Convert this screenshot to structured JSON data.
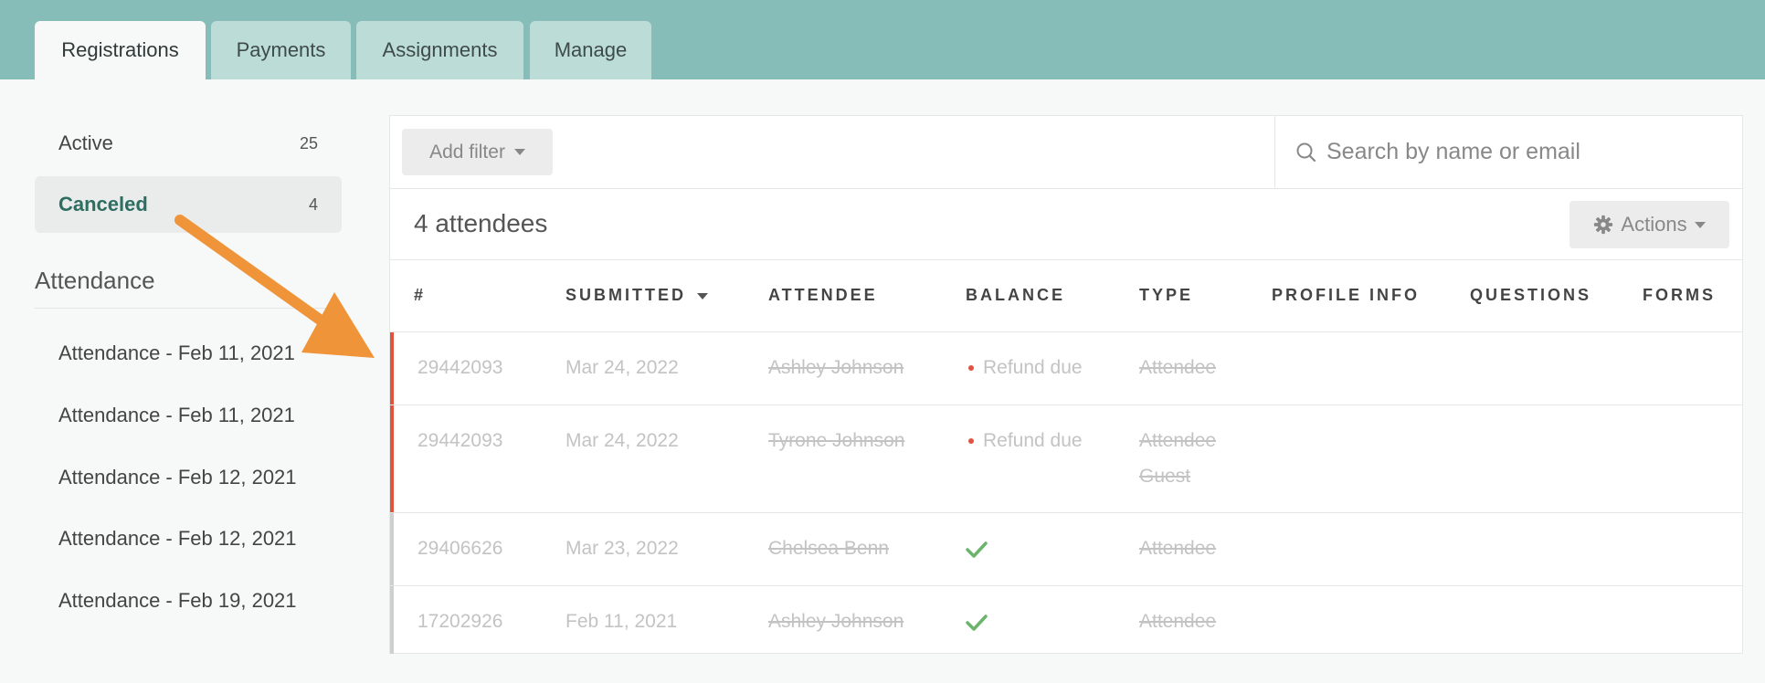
{
  "tabs": [
    {
      "label": "Registrations"
    },
    {
      "label": "Payments"
    },
    {
      "label": "Assignments"
    },
    {
      "label": "Manage"
    }
  ],
  "sidebar": {
    "statuses": [
      {
        "label": "Active",
        "count": "25"
      },
      {
        "label": "Canceled",
        "count": "4"
      }
    ],
    "attendance_heading": "Attendance",
    "attendance_items": [
      {
        "label": "Attendance - Feb 11, 2021"
      },
      {
        "label": "Attendance - Feb 11, 2021"
      },
      {
        "label": "Attendance - Feb 12, 2021"
      },
      {
        "label": "Attendance - Feb 12, 2021"
      },
      {
        "label": "Attendance - Feb 19, 2021"
      }
    ]
  },
  "filter": {
    "add_filter_label": "Add filter",
    "search_placeholder": "Search by name or email"
  },
  "summary": {
    "attendee_count": "4 attendees",
    "actions_label": "Actions"
  },
  "table": {
    "headers": {
      "number": "#",
      "submitted": "SUBMITTED",
      "attendee": "ATTENDEE",
      "balance": "BALANCE",
      "type": "TYPE",
      "profile_info": "PROFILE INFO",
      "questions": "QUESTIONS",
      "forms": "FORMS"
    },
    "rows": [
      {
        "number": "29442093",
        "submitted": "Mar 24, 2022",
        "attendee": "Ashley Johnson",
        "balance": "Refund due",
        "type_1": "Attendee",
        "type_2": ""
      },
      {
        "number": "29442093",
        "submitted": "Mar 24, 2022",
        "attendee": "Tyrone Johnson",
        "balance": "Refund due",
        "type_1": "Attendee",
        "type_2": "Guest"
      },
      {
        "number": "29406626",
        "submitted": "Mar 23, 2022",
        "attendee": "Chelsea Benn",
        "balance": "",
        "type_1": "Attendee",
        "type_2": ""
      },
      {
        "number": "17202926",
        "submitted": "Feb 11, 2021",
        "attendee": "Ashley Johnson",
        "balance": "",
        "type_1": "Attendee",
        "type_2": ""
      }
    ]
  },
  "colors": {
    "header_bg": "#87bdb9",
    "refund_bar": "#e0533f",
    "paid_bar": "#cfcfcf",
    "check": "#6cb46c",
    "arrow": "#f0943a"
  }
}
